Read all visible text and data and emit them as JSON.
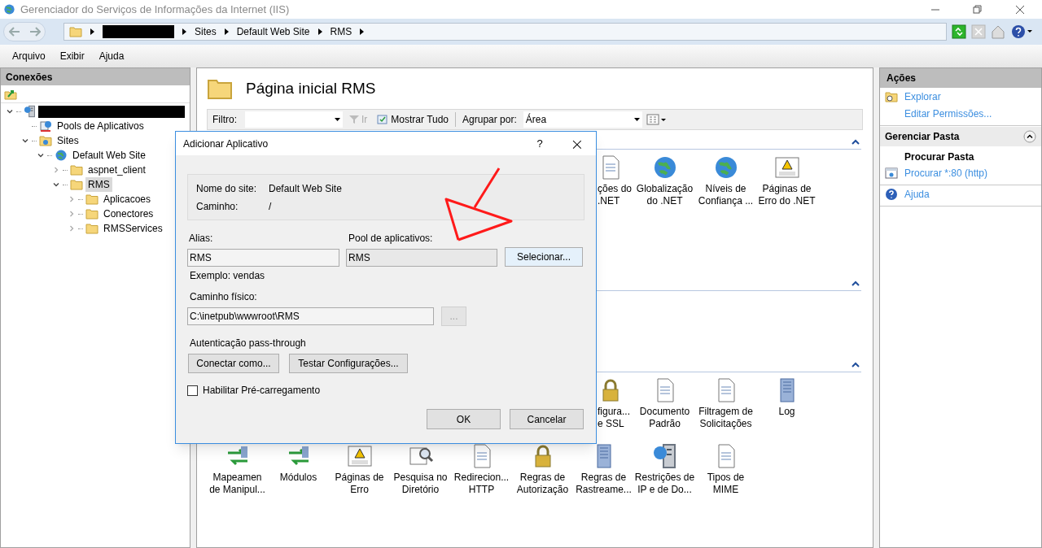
{
  "window": {
    "title": "Gerenciador do Serviços de Informações da Internet (IIS)"
  },
  "address": {
    "crumbs": [
      {
        "kind": "redacted"
      },
      {
        "kind": "text",
        "label": "Sites"
      },
      {
        "kind": "text",
        "label": "Default Web Site"
      },
      {
        "kind": "text",
        "label": "RMS"
      }
    ]
  },
  "menu": [
    "Arquivo",
    "Exibir",
    "Ajuda"
  ],
  "connections": {
    "title": "Conexões",
    "tree": [
      {
        "kind": "server",
        "expanded": true,
        "children": [
          {
            "kind": "pool",
            "label": "Pools de Aplicativos",
            "selected": false
          },
          {
            "kind": "sites",
            "label": "Sites",
            "expanded": true,
            "selected": false,
            "children": [
              {
                "kind": "website",
                "label": "Default Web Site",
                "expanded": true,
                "selected": false,
                "children": [
                  {
                    "kind": "folder",
                    "label": "aspnet_client",
                    "expanded": false,
                    "selected": false
                  },
                  {
                    "kind": "folder",
                    "label": "RMS",
                    "expanded": true,
                    "selected": true,
                    "children": [
                      {
                        "kind": "folder",
                        "label": "Aplicacoes",
                        "expanded": false,
                        "selected": false
                      },
                      {
                        "kind": "folder",
                        "label": "Conectores",
                        "expanded": false,
                        "selected": false
                      },
                      {
                        "kind": "folder",
                        "label": "RMSServices",
                        "expanded": false,
                        "selected": false
                      }
                    ]
                  }
                ]
              }
            ]
          }
        ]
      }
    ]
  },
  "home": {
    "title": "Página inicial RMS",
    "filter": {
      "label": "Filtro:",
      "go": "Ir",
      "go_disabled": true,
      "show_all": "Mostrar Tudo",
      "group_label": "Agrupar por:",
      "group_value": "Área"
    },
    "sections": [
      {
        "expanded": true,
        "rows": [
          [
            "",
            "",
            "",
            "",
            "",
            "",
            {
              "kind": "doc",
              "partial": true,
              "label": "ções do\n.NET"
            },
            {
              "kind": "globe",
              "partial": false,
              "label": "Globalização\ndo .NET"
            },
            {
              "kind": "globe",
              "partial": false,
              "label": "Níveis de\nConfiança ..."
            },
            {
              "kind": "warning",
              "partial": false,
              "label": "Páginas de\nErro do .NET"
            }
          ]
        ]
      },
      {
        "expanded": true
      },
      {
        "expanded": true,
        "rows": [
          [
            "",
            "",
            "",
            "",
            "",
            "",
            {
              "kind": "lock",
              "partial": true,
              "label": "figura...\ne SSL"
            },
            {
              "kind": "doc",
              "partial": false,
              "label": "Documento\nPadrão"
            },
            {
              "kind": "doc",
              "partial": false,
              "label": "Filtragem de\nSolicitações"
            },
            {
              "kind": "book",
              "partial": false,
              "label": "Log"
            }
          ],
          [
            {
              "kind": "arrows",
              "partial": false,
              "label": "Mapeamen\nde Manipul..."
            },
            {
              "kind": "arrows",
              "partial": false,
              "label": "Módulos"
            },
            {
              "kind": "warning",
              "partial": false,
              "label": "Páginas de\nErro"
            },
            {
              "kind": "search",
              "partial": false,
              "label": "Pesquisa no\nDiretório"
            },
            {
              "kind": "doc",
              "partial": false,
              "label": "Redirecion...\nHTTP"
            },
            {
              "kind": "lock",
              "partial": false,
              "label": "Regras de\nAutorização"
            },
            {
              "kind": "book",
              "partial": false,
              "label": "Regras de\nRastreame..."
            },
            {
              "kind": "server",
              "partial": false,
              "label": "Restrições de\nIP e de Do..."
            },
            {
              "kind": "doc",
              "partial": false,
              "label": "Tipos de\nMIME"
            }
          ]
        ]
      }
    ]
  },
  "actions": {
    "title": "Ações",
    "groups": [
      {
        "items": [
          {
            "kind": "explore",
            "label": "Explorar"
          },
          {
            "kind": "none",
            "label": "Editar Permissões..."
          }
        ]
      },
      {
        "title": "Gerenciar Pasta",
        "expanded": true,
        "subtitle": "Procurar Pasta",
        "items": [
          {
            "kind": "browse",
            "label": "Procurar *:80 (http)"
          }
        ]
      },
      {
        "items": [
          {
            "kind": "help",
            "label": "Ajuda"
          }
        ]
      }
    ]
  },
  "dialog": {
    "title": "Adicionar Aplicativo",
    "help": "?",
    "close": "×",
    "site_label": "Nome do site:",
    "site_value": "Default Web Site",
    "path_label": "Caminho:",
    "path_value": "/",
    "alias_label": "Alias:",
    "alias_value": "RMS",
    "pool_label": "Pool de aplicativos:",
    "pool_value": "RMS",
    "select_button": "Selecionar...",
    "example": "Exemplo: vendas",
    "physical_label": "Caminho físico:",
    "physical_value": "C:\\inetpub\\wwwroot\\RMS",
    "browse_button": "...",
    "browse_disabled": true,
    "auth_label": "Autenticação pass-through",
    "connect_button": "Conectar como...",
    "test_button": "Testar Configurações...",
    "preload": {
      "label": "Habilitar Pré-carregamento",
      "checked": false
    },
    "buttons": [
      "OK",
      "Cancelar"
    ]
  }
}
